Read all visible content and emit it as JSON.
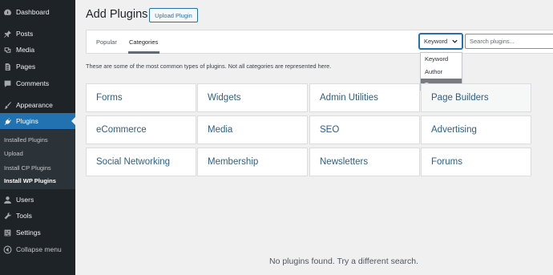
{
  "sidebar": {
    "items": [
      {
        "label": "Dashboard",
        "icon": "dashboard-icon"
      },
      {
        "label": "Posts",
        "icon": "pin-icon"
      },
      {
        "label": "Media",
        "icon": "media-icon"
      },
      {
        "label": "Pages",
        "icon": "pages-icon"
      },
      {
        "label": "Comments",
        "icon": "comment-icon"
      },
      {
        "label": "Appearance",
        "icon": "brush-icon"
      },
      {
        "label": "Plugins",
        "icon": "plugin-icon"
      },
      {
        "label": "Users",
        "icon": "user-icon"
      },
      {
        "label": "Tools",
        "icon": "wrench-icon"
      },
      {
        "label": "Settings",
        "icon": "settings-icon"
      },
      {
        "label": "Collapse menu",
        "icon": "collapse-icon"
      }
    ],
    "submenu": [
      "Installed Plugins",
      "Upload",
      "Install CP Plugins",
      "Install WP Plugins"
    ]
  },
  "header": {
    "title": "Add Plugins",
    "upload_label": "Upload Plugin"
  },
  "filter": {
    "tabs": [
      "Popular",
      "Categories"
    ],
    "search_type_value": "Keyword",
    "search_type_options": [
      "Keyword",
      "Author",
      "Tag"
    ],
    "search_placeholder": "Search plugins..."
  },
  "description": "These are some of the most common types of plugins. Not all categories are represented here.",
  "categories": [
    "Forms",
    "Widgets",
    "Admin Utilities",
    "Page Builders",
    "eCommerce",
    "Media",
    "SEO",
    "Advertising",
    "Social Networking",
    "Membership",
    "Newsletters",
    "Forums"
  ],
  "empty_message": "No plugins found. Try a different search.",
  "colors": {
    "sidebar_bg": "#1d2327",
    "accent": "#2271b1",
    "link": "#2c5f8a",
    "page_bg": "#f0f0f1"
  }
}
